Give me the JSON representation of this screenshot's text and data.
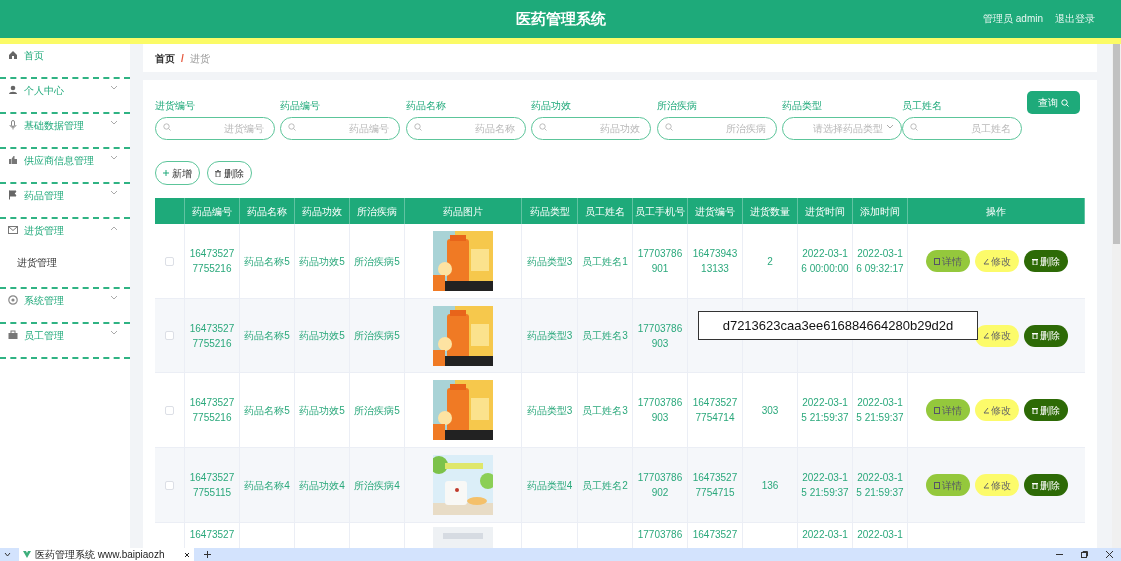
{
  "header": {
    "title": "医药管理系统",
    "user": "管理员 admin",
    "logout": "退出登录"
  },
  "sidebar": {
    "items": [
      {
        "label": "首页"
      },
      {
        "label": "个人中心",
        "expanded": false
      },
      {
        "label": "基础数据管理",
        "expanded": false
      },
      {
        "label": "供应商信息管理",
        "expanded": false
      },
      {
        "label": "药品管理",
        "expanded": false
      },
      {
        "label": "进货管理",
        "expanded": true,
        "children": [
          {
            "label": "进货管理"
          }
        ]
      },
      {
        "label": "系统管理",
        "expanded": false
      },
      {
        "label": "员工管理",
        "expanded": false
      }
    ]
  },
  "breadcrumb": [
    {
      "label": "首页",
      "selected": false
    },
    {
      "label": "/",
      "kind": "separator"
    },
    {
      "label": "进货",
      "selected": true
    }
  ],
  "search": {
    "fields": [
      {
        "label": "进货编号",
        "placeholder": "进货编号",
        "kind": "input"
      },
      {
        "label": "药品编号",
        "placeholder": "药品编号",
        "kind": "input"
      },
      {
        "label": "药品名称",
        "placeholder": "药品名称",
        "kind": "input"
      },
      {
        "label": "药品功效",
        "placeholder": "药品功效",
        "kind": "input"
      },
      {
        "label": "所治疾病",
        "placeholder": "所治疾病",
        "kind": "input"
      },
      {
        "label": "药品类型",
        "placeholder": "请选择药品类型",
        "kind": "select"
      },
      {
        "label": "员工姓名",
        "placeholder": "员工姓名",
        "kind": "input"
      }
    ],
    "query_button": "查询"
  },
  "actions": [
    {
      "label": "新增",
      "kind": "add"
    },
    {
      "label": "删除",
      "kind": "delete"
    }
  ],
  "table": {
    "columns": [
      "药品编号",
      "药品名称",
      "药品功效",
      "所治疾病",
      "药品图片",
      "药品类型",
      "员工姓名",
      "员工手机号",
      "进货编号",
      "进货数量",
      "进货时间",
      "添加时间",
      "操作"
    ],
    "rows": [
      {
        "checked": false,
        "cells": [
          "164735277755216",
          "药品名称5",
          "药品功效5",
          "所治疾病5",
          {
            "kind": "picture"
          },
          "药品类型3",
          "员工姓名1",
          "17703786901",
          "1647394313133",
          "2",
          "2022-03-16 00:00:00",
          "2022-03-16 09:32:17"
        ],
        "buttons": [
          {
            "label": "详情",
            "kind": "detail"
          },
          {
            "label": "修改",
            "kind": "edit"
          },
          {
            "label": "删除",
            "kind": "delete"
          }
        ]
      },
      {
        "checked": false,
        "cells": [
          "164735277755216",
          "药品名称5",
          "药品功效5",
          "所治疾病5",
          {
            "kind": "picture"
          },
          "药品类型3",
          "员工姓名3",
          "17703786903"
        ],
        "buttons": [
          {
            "label": "修改",
            "kind": "edit"
          },
          {
            "label": "删除",
            "kind": "delete"
          }
        ]
      },
      {
        "checked": false,
        "cells": [
          "164735277755216",
          "药品名称5",
          "药品功效5",
          "所治疾病5",
          {
            "kind": "picture"
          },
          "药品类型3",
          "员工姓名3",
          "17703786903",
          "164735277754714",
          "303",
          "2022-03-15 21:59:37",
          "2022-03-15 21:59:37"
        ],
        "buttons": [
          {
            "label": "详情",
            "kind": "detail"
          },
          {
            "label": "修改",
            "kind": "edit"
          },
          {
            "label": "删除",
            "kind": "delete"
          }
        ]
      },
      {
        "checked": false,
        "cells": [
          "164735277755115",
          "药品名称4",
          "药品功效4",
          "所治疾病4",
          {
            "kind": "picture"
          },
          "药品类型4",
          "员工姓名2",
          "17703786902",
          "164735277754715",
          "136",
          "2022-03-15 21:59:37",
          "2022-03-15 21:59:37"
        ],
        "buttons": [
          {
            "label": "详情",
            "kind": "detail"
          },
          {
            "label": "修改",
            "kind": "edit"
          },
          {
            "label": "删除",
            "kind": "delete"
          }
        ]
      },
      {
        "cells": [
          "16473527",
          null,
          null,
          null,
          {
            "kind": "picture"
          },
          null,
          null,
          "17703786",
          "16473527",
          null,
          "2022-03-1",
          "2022-03-1"
        ]
      }
    ]
  },
  "overlay_label": {
    "text": "d7213623caa3ee616884664280b29d2d"
  },
  "browser_tab": {
    "title": "医药管理系统 www.baipiaozh"
  }
}
